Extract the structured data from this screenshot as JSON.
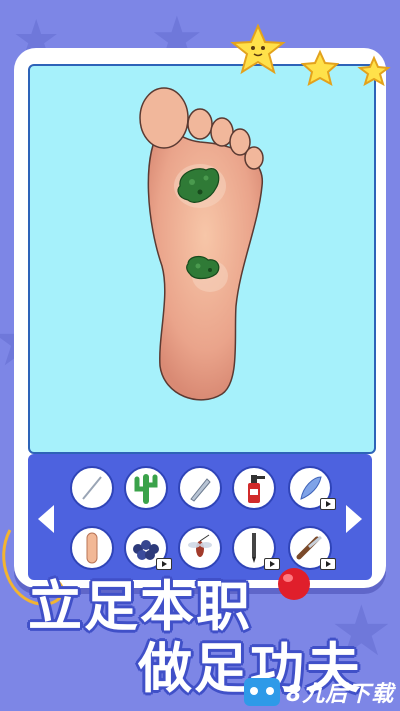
{
  "headline": {
    "line1": "立足本职",
    "line2": "做足功夫"
  },
  "watermark": {
    "text": "8九后下载",
    "icon": "robot-logo-icon"
  },
  "stars": {
    "count_shown": 3,
    "icon": "star-icon"
  },
  "tools": {
    "row1": [
      {
        "icon": "needle-icon",
        "video": false
      },
      {
        "icon": "cactus-icon",
        "video": false
      },
      {
        "icon": "tweezers-icon",
        "video": false
      },
      {
        "icon": "spray-bottle-icon",
        "video": false
      },
      {
        "icon": "feather-icon",
        "video": true
      }
    ],
    "row2": [
      {
        "icon": "finger-icon",
        "video": false
      },
      {
        "icon": "blueberries-icon",
        "video": true
      },
      {
        "icon": "mosquito-icon",
        "video": false
      },
      {
        "icon": "pen-icon",
        "video": true
      },
      {
        "icon": "razor-icon",
        "video": true
      }
    ]
  },
  "colors": {
    "background": "#7d86e6",
    "panel": "#a6f1fb",
    "tray": "#4d62df",
    "wart": "#2f7a36",
    "star": "#ffe14a"
  }
}
